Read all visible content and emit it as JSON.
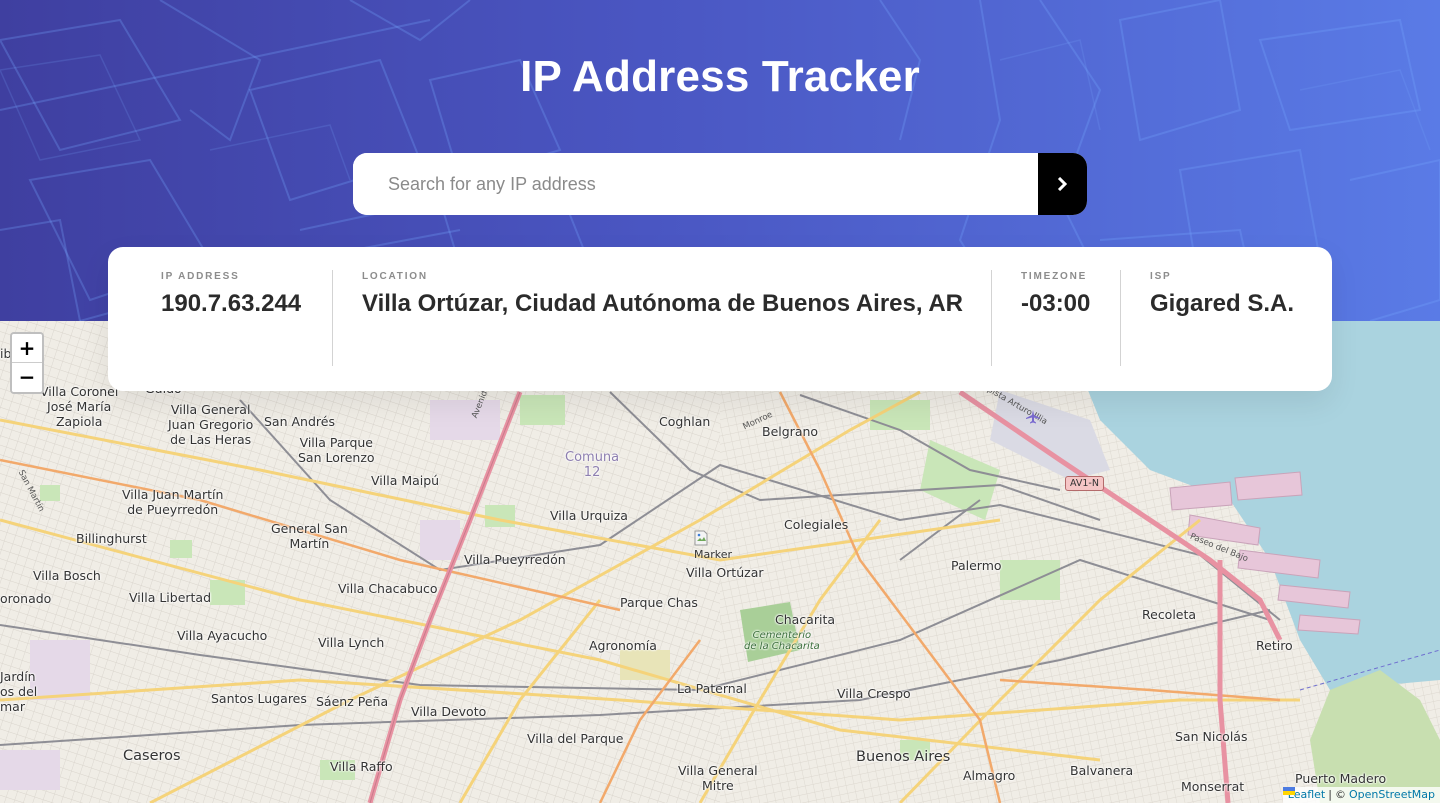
{
  "header": {
    "title": "IP Address Tracker",
    "gradient_from": "#3f3fa0",
    "gradient_to": "#5a7be6"
  },
  "search": {
    "placeholder": "Search for any IP address",
    "value": "",
    "button_icon": "chevron-right-icon"
  },
  "info": {
    "ip": {
      "label": "IP ADDRESS",
      "value": "190.7.63.244"
    },
    "location": {
      "label": "LOCATION",
      "value": "Villa Ortúzar, Ciudad Autónoma de Buenos Aires, AR"
    },
    "timezone": {
      "label": "TIMEZONE",
      "value": "-03:00"
    },
    "isp": {
      "label": "ISP",
      "value": "Gigared S.A."
    }
  },
  "map": {
    "zoom_in": "+",
    "zoom_out": "−",
    "marker_alt": "Marker",
    "attribution_leaflet": "Leaflet",
    "attribution_separator": "|",
    "attribution_copyright": "©",
    "attribution_osm": "OpenStreetMap",
    "labels": {
      "villa_coronel": "Villa Coronel\nJosé María\nZapiola",
      "villa_general_juan": "Villa General\nJuan Gregorio\nde Las Heras",
      "san_andres": "San Andrés",
      "villa_parque_sl": "Villa Parque\nSan Lorenzo",
      "coghlan": "Coghlan",
      "belgrano": "Belgrano",
      "comuna": "Comuna\n12",
      "villa_maipu": "Villa Maipú",
      "villa_juan_martin": "Villa Juan Martín\nde Pueyrredón",
      "general_san_martin": "General San\nMartín",
      "villa_urquiza": "Villa Urquiza",
      "colegiales": "Colegiales",
      "billinghurst": "Billinghurst",
      "villa_pueyrredon": "Villa Pueyrredón",
      "villa_ortuzar": "Villa Ortúzar",
      "palermo": "Palermo",
      "villa_bosch": "Villa Bosch",
      "villa_chacabuco": "Villa Chacabuco",
      "parque_chas": "Parque Chas",
      "coronado": "oronado",
      "villa_libertad": "Villa Libertad",
      "chacarita": "Chacarita",
      "cementerio": "Cementerio\nde la Chacarita",
      "recoleta": "Recoleta",
      "villa_ayacucho": "Villa Ayacucho",
      "villa_lynch": "Villa Lynch",
      "agronomia": "Agronomía",
      "retiro": "Retiro",
      "jardin": "Jardín\nos del\nmar",
      "la_paternal": "La Paternal",
      "villa_crespo": "Villa Crespo",
      "santos_lugares": "Santos Lugares",
      "saenz_pena": "Sáenz Peña",
      "villa_devoto": "Villa Devoto",
      "san_nicolas": "San Nicolás",
      "villa_del_parque": "Villa del Parque",
      "caseros": "Caseros",
      "buenos_aires": "Buenos Aires",
      "villa_raffo": "Villa Raffo",
      "villa_general_mitre": "Villa General\nMitre",
      "almagro": "Almagro",
      "balvanera": "Balvanera",
      "monserrat": "Monserrat",
      "puerto_madero": "Puerto Madero",
      "guido": "Guido",
      "ibe": "ibe",
      "av1n": "AV1-N",
      "paseo_del_bajo": "Paseo del Bajo",
      "av_general_paz": "Avenida General Paz",
      "monroe": "Monroe",
      "autopista": "Autopista Arturo Illia",
      "san_martin_road": "San Martín"
    }
  }
}
